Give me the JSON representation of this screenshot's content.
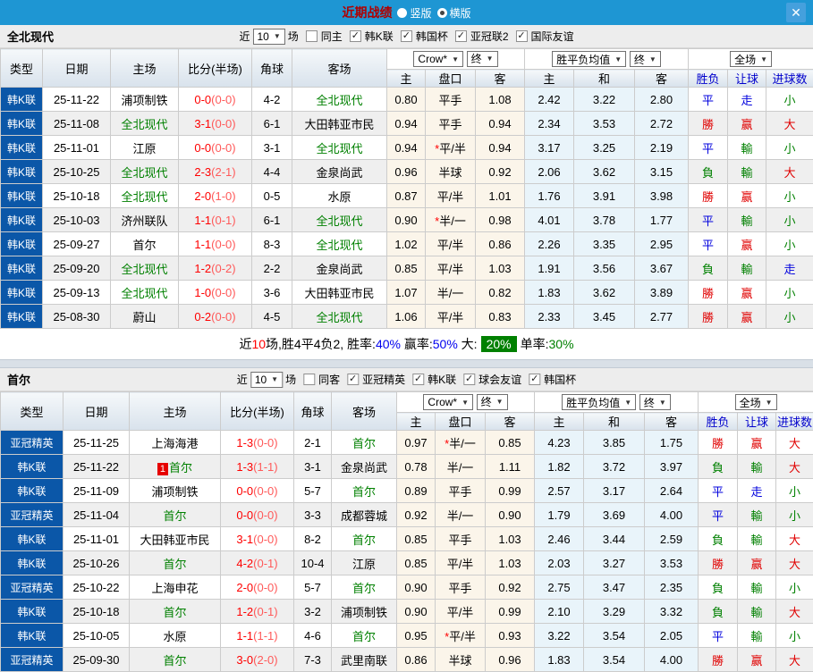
{
  "icons": {
    "close": "✕",
    "arrow": "▼",
    "check": "✓"
  },
  "colors": {
    "topbar": "#1e96d3",
    "league_bg": "#0b57a8",
    "team_green": "#008000",
    "win_red": "#e00000",
    "draw_blue": "#0000dd",
    "badge_green": "#008000"
  },
  "titlebar": {
    "title": "近期战绩",
    "vertical": "竖版",
    "horizontal": "横版"
  },
  "filter": {
    "near": "近",
    "count": "10",
    "games": "场"
  },
  "columns": {
    "type": "类型",
    "date": "日期",
    "home": "主场",
    "score": "比分(半场)",
    "corner": "角球",
    "away": "客场",
    "crow": "Crow*",
    "final": "终",
    "avg": "胜平负均值",
    "full": "全场",
    "h": "主",
    "handicap": "盘口",
    "a": "客",
    "avg_h": "主",
    "avg_d": "和",
    "avg_a": "客",
    "wdl": "胜负",
    "let": "让球",
    "goals": "进球数"
  },
  "sections": [
    {
      "team": "全北现代",
      "same": "同主",
      "leagues": [
        "韩K联",
        "韩国杯",
        "亚冠联2",
        "国际友谊"
      ],
      "rows": [
        {
          "lg": "韩K联",
          "dt": "25-11-22",
          "hm": "浦项制铁",
          "hg": false,
          "sc": "0-0",
          "hf": "(0-0)",
          "cr": "4-2",
          "aw": "全北现代",
          "ag": true,
          "o1": "0.80",
          "st": false,
          "hc": "平手",
          "o2": "1.08",
          "a1": "2.42",
          "a2": "3.22",
          "a3": "2.80",
          "r1": "平",
          "c1": "blue",
          "r2": "走",
          "c2": "blue",
          "r3": "小",
          "c3": "green"
        },
        {
          "lg": "韩K联",
          "dt": "25-11-08",
          "hm": "全北现代",
          "hg": true,
          "sc": "3-1",
          "hf": "(0-0)",
          "cr": "6-1",
          "aw": "大田韩亚市民",
          "ag": false,
          "o1": "0.94",
          "st": false,
          "hc": "平手",
          "o2": "0.94",
          "a1": "2.34",
          "a2": "3.53",
          "a3": "2.72",
          "r1": "勝",
          "c1": "red",
          "r2": "赢",
          "c2": "red",
          "r3": "大",
          "c3": "red"
        },
        {
          "lg": "韩K联",
          "dt": "25-11-01",
          "hm": "江原",
          "hg": false,
          "sc": "0-0",
          "hf": "(0-0)",
          "cr": "3-1",
          "aw": "全北现代",
          "ag": true,
          "o1": "0.94",
          "st": true,
          "hc": "平/半",
          "o2": "0.94",
          "a1": "3.17",
          "a2": "3.25",
          "a3": "2.19",
          "r1": "平",
          "c1": "blue",
          "r2": "輸",
          "c2": "green",
          "r3": "小",
          "c3": "green"
        },
        {
          "lg": "韩K联",
          "dt": "25-10-25",
          "hm": "全北现代",
          "hg": true,
          "sc": "2-3",
          "hf": "(2-1)",
          "cr": "4-4",
          "aw": "金泉尚武",
          "ag": false,
          "o1": "0.96",
          "st": false,
          "hc": "半球",
          "o2": "0.92",
          "a1": "2.06",
          "a2": "3.62",
          "a3": "3.15",
          "r1": "負",
          "c1": "green",
          "r2": "輸",
          "c2": "green",
          "r3": "大",
          "c3": "red"
        },
        {
          "lg": "韩K联",
          "dt": "25-10-18",
          "hm": "全北现代",
          "hg": true,
          "sc": "2-0",
          "hf": "(1-0)",
          "cr": "0-5",
          "aw": "水原",
          "ag": false,
          "o1": "0.87",
          "st": false,
          "hc": "平/半",
          "o2": "1.01",
          "a1": "1.76",
          "a2": "3.91",
          "a3": "3.98",
          "r1": "勝",
          "c1": "red",
          "r2": "赢",
          "c2": "red",
          "r3": "小",
          "c3": "green"
        },
        {
          "lg": "韩K联",
          "dt": "25-10-03",
          "hm": "济州联队",
          "hg": false,
          "sc": "1-1",
          "hf": "(0-1)",
          "cr": "6-1",
          "aw": "全北现代",
          "ag": true,
          "o1": "0.90",
          "st": true,
          "hc": "半/一",
          "o2": "0.98",
          "a1": "4.01",
          "a2": "3.78",
          "a3": "1.77",
          "r1": "平",
          "c1": "blue",
          "r2": "輸",
          "c2": "green",
          "r3": "小",
          "c3": "green"
        },
        {
          "lg": "韩K联",
          "dt": "25-09-27",
          "hm": "首尔",
          "hg": false,
          "sc": "1-1",
          "hf": "(0-0)",
          "cr": "8-3",
          "aw": "全北现代",
          "ag": true,
          "o1": "1.02",
          "st": false,
          "hc": "平/半",
          "o2": "0.86",
          "a1": "2.26",
          "a2": "3.35",
          "a3": "2.95",
          "r1": "平",
          "c1": "blue",
          "r2": "赢",
          "c2": "red",
          "r3": "小",
          "c3": "green"
        },
        {
          "lg": "韩K联",
          "dt": "25-09-20",
          "hm": "全北现代",
          "hg": true,
          "sc": "1-2",
          "hf": "(0-2)",
          "cr": "2-2",
          "aw": "金泉尚武",
          "ag": false,
          "o1": "0.85",
          "st": false,
          "hc": "平/半",
          "o2": "1.03",
          "a1": "1.91",
          "a2": "3.56",
          "a3": "3.67",
          "r1": "負",
          "c1": "green",
          "r2": "輸",
          "c2": "green",
          "r3": "走",
          "c3": "blue"
        },
        {
          "lg": "韩K联",
          "dt": "25-09-13",
          "hm": "全北现代",
          "hg": true,
          "sc": "1-0",
          "hf": "(0-0)",
          "cr": "3-6",
          "aw": "大田韩亚市民",
          "ag": false,
          "o1": "1.07",
          "st": false,
          "hc": "半/一",
          "o2": "0.82",
          "a1": "1.83",
          "a2": "3.62",
          "a3": "3.89",
          "r1": "勝",
          "c1": "red",
          "r2": "赢",
          "c2": "red",
          "r3": "小",
          "c3": "green"
        },
        {
          "lg": "韩K联",
          "dt": "25-08-30",
          "hm": "蔚山",
          "hg": false,
          "sc": "0-2",
          "hf": "(0-0)",
          "cr": "4-5",
          "aw": "全北现代",
          "ag": true,
          "o1": "1.06",
          "st": false,
          "hc": "平/半",
          "o2": "0.83",
          "a1": "2.33",
          "a2": "3.45",
          "a3": "2.77",
          "r1": "勝",
          "c1": "red",
          "r2": "赢",
          "c2": "red",
          "r3": "小",
          "c3": "green"
        }
      ],
      "summary": [
        {
          "t": "近"
        },
        {
          "t": "10",
          "c": "red"
        },
        {
          "t": "场,胜4平4负2, "
        },
        {
          "t": "胜率:"
        },
        {
          "t": "40%",
          "c": "blue"
        },
        {
          "t": " 赢率:"
        },
        {
          "t": "50%",
          "c": "blue"
        },
        {
          "t": " 大:"
        },
        {
          "t": "20%",
          "c": "badge"
        },
        {
          "t": "单率:"
        },
        {
          "t": "30%",
          "c": "green"
        }
      ]
    },
    {
      "team": "首尔",
      "same": "同客",
      "leagues": [
        "亚冠精英",
        "韩K联",
        "球会友谊",
        "韩国杯"
      ],
      "rows": [
        {
          "lg": "亚冠精英",
          "dt": "25-11-25",
          "hm": "上海海港",
          "hg": false,
          "sc": "1-3",
          "hf": "(0-0)",
          "cr": "2-1",
          "aw": "首尔",
          "ag": true,
          "o1": "0.97",
          "st": true,
          "hc": "半/一",
          "o2": "0.85",
          "a1": "4.23",
          "a2": "3.85",
          "a3": "1.75",
          "r1": "勝",
          "c1": "red",
          "r2": "赢",
          "c2": "red",
          "r3": "大",
          "c3": "red"
        },
        {
          "lg": "韩K联",
          "dt": "25-11-22",
          "hm": "首尔",
          "hg": true,
          "hb": "1",
          "sc": "1-3",
          "hf": "(1-1)",
          "cr": "3-1",
          "aw": "金泉尚武",
          "ag": false,
          "o1": "0.78",
          "st": false,
          "hc": "半/一",
          "o2": "1.11",
          "a1": "1.82",
          "a2": "3.72",
          "a3": "3.97",
          "r1": "負",
          "c1": "green",
          "r2": "輸",
          "c2": "green",
          "r3": "大",
          "c3": "red"
        },
        {
          "lg": "韩K联",
          "dt": "25-11-09",
          "hm": "浦项制铁",
          "hg": false,
          "sc": "0-0",
          "hf": "(0-0)",
          "cr": "5-7",
          "aw": "首尔",
          "ag": true,
          "o1": "0.89",
          "st": false,
          "hc": "平手",
          "o2": "0.99",
          "a1": "2.57",
          "a2": "3.17",
          "a3": "2.64",
          "r1": "平",
          "c1": "blue",
          "r2": "走",
          "c2": "blue",
          "r3": "小",
          "c3": "green"
        },
        {
          "lg": "亚冠精英",
          "dt": "25-11-04",
          "hm": "首尔",
          "hg": true,
          "sc": "0-0",
          "hf": "(0-0)",
          "cr": "3-3",
          "aw": "成都蓉城",
          "ag": false,
          "o1": "0.92",
          "st": false,
          "hc": "半/一",
          "o2": "0.90",
          "a1": "1.79",
          "a2": "3.69",
          "a3": "4.00",
          "r1": "平",
          "c1": "blue",
          "r2": "輸",
          "c2": "green",
          "r3": "小",
          "c3": "green"
        },
        {
          "lg": "韩K联",
          "dt": "25-11-01",
          "hm": "大田韩亚市民",
          "hg": false,
          "sc": "3-1",
          "hf": "(0-0)",
          "cr": "8-2",
          "aw": "首尔",
          "ag": true,
          "o1": "0.85",
          "st": false,
          "hc": "平手",
          "o2": "1.03",
          "a1": "2.46",
          "a2": "3.44",
          "a3": "2.59",
          "r1": "負",
          "c1": "green",
          "r2": "輸",
          "c2": "green",
          "r3": "大",
          "c3": "red"
        },
        {
          "lg": "韩K联",
          "dt": "25-10-26",
          "hm": "首尔",
          "hg": true,
          "sc": "4-2",
          "hf": "(0-1)",
          "cr": "10-4",
          "aw": "江原",
          "ag": false,
          "o1": "0.85",
          "st": false,
          "hc": "平/半",
          "o2": "1.03",
          "a1": "2.03",
          "a2": "3.27",
          "a3": "3.53",
          "r1": "勝",
          "c1": "red",
          "r2": "赢",
          "c2": "red",
          "r3": "大",
          "c3": "red"
        },
        {
          "lg": "亚冠精英",
          "dt": "25-10-22",
          "hm": "上海申花",
          "hg": false,
          "sc": "2-0",
          "hf": "(0-0)",
          "cr": "5-7",
          "aw": "首尔",
          "ag": true,
          "o1": "0.90",
          "st": false,
          "hc": "平手",
          "o2": "0.92",
          "a1": "2.75",
          "a2": "3.47",
          "a3": "2.35",
          "r1": "負",
          "c1": "green",
          "r2": "輸",
          "c2": "green",
          "r3": "小",
          "c3": "green"
        },
        {
          "lg": "韩K联",
          "dt": "25-10-18",
          "hm": "首尔",
          "hg": true,
          "sc": "1-2",
          "hf": "(0-1)",
          "cr": "3-2",
          "aw": "浦项制铁",
          "ag": false,
          "o1": "0.90",
          "st": false,
          "hc": "平/半",
          "o2": "0.99",
          "a1": "2.10",
          "a2": "3.29",
          "a3": "3.32",
          "r1": "負",
          "c1": "green",
          "r2": "輸",
          "c2": "green",
          "r3": "大",
          "c3": "red"
        },
        {
          "lg": "韩K联",
          "dt": "25-10-05",
          "hm": "水原",
          "hg": false,
          "sc": "1-1",
          "hf": "(1-1)",
          "cr": "4-6",
          "aw": "首尔",
          "ag": true,
          "o1": "0.95",
          "st": true,
          "hc": "平/半",
          "o2": "0.93",
          "a1": "3.22",
          "a2": "3.54",
          "a3": "2.05",
          "r1": "平",
          "c1": "blue",
          "r2": "輸",
          "c2": "green",
          "r3": "小",
          "c3": "green"
        },
        {
          "lg": "亚冠精英",
          "dt": "25-09-30",
          "hm": "首尔",
          "hg": true,
          "sc": "3-0",
          "hf": "(2-0)",
          "cr": "7-3",
          "aw": "武里南联",
          "ag": false,
          "o1": "0.86",
          "st": false,
          "hc": "半球",
          "o2": "0.96",
          "a1": "1.83",
          "a2": "3.54",
          "a3": "4.00",
          "r1": "勝",
          "c1": "red",
          "r2": "赢",
          "c2": "red",
          "r3": "大",
          "c3": "red"
        }
      ]
    }
  ]
}
